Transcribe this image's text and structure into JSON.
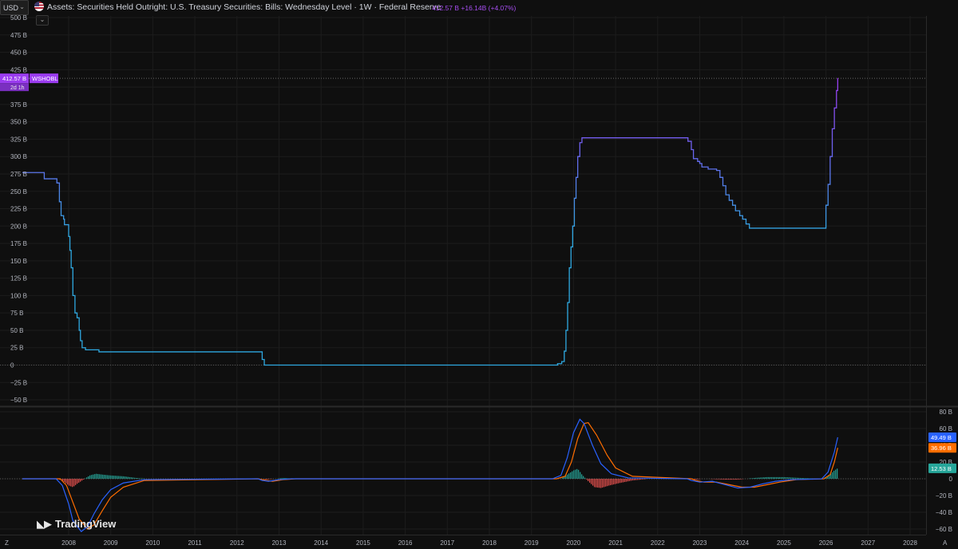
{
  "header": {
    "currency": "USD",
    "title": "Assets: Securities Held Outright: U.S. Treasury Securities: Bills: Wednesday Level · 1W · Federal Reserve",
    "value_text": "412.57 B  +16.14B (+4.07%)",
    "collapse_glyph": "⌄"
  },
  "brand": {
    "name": "TradingView"
  },
  "corner": {
    "left": "Z",
    "right": "A"
  },
  "colors": {
    "background": "#0f0f0f",
    "line_start": "#2ea8e0",
    "line_end": "#9b3cf0",
    "macd_line": "#2962ff",
    "signal_line": "#ff6d00",
    "hist_pos": "#26a69a",
    "hist_neg": "#ef5350"
  },
  "chart_data": [
    {
      "type": "line",
      "series": [
        {
          "name": "WSHOBL",
          "points": [
            [
              2006.9,
              277
            ],
            [
              2007.4,
              277
            ],
            [
              2007.42,
              268
            ],
            [
              2007.7,
              268
            ],
            [
              2007.72,
              262
            ],
            [
              2007.78,
              235
            ],
            [
              2007.82,
              215
            ],
            [
              2007.88,
              210
            ],
            [
              2007.9,
              202
            ],
            [
              2007.98,
              202
            ],
            [
              2008.0,
              185
            ],
            [
              2008.03,
              165
            ],
            [
              2008.06,
              140
            ],
            [
              2008.1,
              100
            ],
            [
              2008.15,
              75
            ],
            [
              2008.2,
              68
            ],
            [
              2008.25,
              50
            ],
            [
              2008.28,
              35
            ],
            [
              2008.32,
              25
            ],
            [
              2008.4,
              22
            ],
            [
              2008.7,
              22
            ],
            [
              2008.72,
              19
            ],
            [
              2012.55,
              19
            ],
            [
              2012.6,
              8
            ],
            [
              2012.65,
              0
            ],
            [
              2019.55,
              0
            ],
            [
              2019.62,
              2
            ],
            [
              2019.72,
              5
            ],
            [
              2019.78,
              20
            ],
            [
              2019.82,
              50
            ],
            [
              2019.86,
              90
            ],
            [
              2019.9,
              140
            ],
            [
              2019.94,
              170
            ],
            [
              2019.98,
              200
            ],
            [
              2020.02,
              240
            ],
            [
              2020.06,
              270
            ],
            [
              2020.1,
              300
            ],
            [
              2020.15,
              320
            ],
            [
              2020.2,
              327
            ],
            [
              2022.7,
              327
            ],
            [
              2022.72,
              322
            ],
            [
              2022.8,
              310
            ],
            [
              2022.85,
              297
            ],
            [
              2022.95,
              293
            ],
            [
              2023.0,
              290
            ],
            [
              2023.05,
              285
            ],
            [
              2023.2,
              282
            ],
            [
              2023.4,
              280
            ],
            [
              2023.48,
              270
            ],
            [
              2023.55,
              258
            ],
            [
              2023.62,
              245
            ],
            [
              2023.7,
              237
            ],
            [
              2023.78,
              230
            ],
            [
              2023.85,
              222
            ],
            [
              2023.95,
              215
            ],
            [
              2024.02,
              210
            ],
            [
              2024.1,
              203
            ],
            [
              2024.18,
              197
            ],
            [
              2025.95,
              197
            ],
            [
              2026.0,
              230
            ],
            [
              2026.05,
              260
            ],
            [
              2026.1,
              300
            ],
            [
              2026.15,
              340
            ],
            [
              2026.2,
              370
            ],
            [
              2026.25,
              395
            ],
            [
              2026.28,
              413
            ]
          ]
        }
      ],
      "x_ticks": [
        "2008",
        "2009",
        "2010",
        "2011",
        "2012",
        "2013",
        "2014",
        "2015",
        "2016",
        "2017",
        "2018",
        "2019",
        "2020",
        "2021",
        "2022",
        "2023",
        "2024",
        "2025",
        "2026",
        "2027",
        "2028"
      ],
      "y_ticks": [
        "500 B",
        "475 B",
        "450 B",
        "425 B",
        "400 B",
        "375 B",
        "350 B",
        "325 B",
        "300 B",
        "275 B",
        "250 B",
        "225 B",
        "200 B",
        "175 B",
        "150 B",
        "125 B",
        "100 B",
        "75 B",
        "50 B",
        "25 B",
        "0",
        "−25 B",
        "−50 B"
      ],
      "ylim": [
        -50,
        500
      ],
      "xlim": [
        2006.93,
        2028.86
      ],
      "last_label": {
        "value": 412.57,
        "text": "412.57 B",
        "symbol": "WSHOBL",
        "countdown": "2d 1h"
      }
    },
    {
      "type": "line",
      "series": [
        {
          "name": "MACD",
          "points": [
            [
              2006.9,
              0
            ],
            [
              2007.7,
              0
            ],
            [
              2007.85,
              -8
            ],
            [
              2008.0,
              -30
            ],
            [
              2008.1,
              -50
            ],
            [
              2008.3,
              -63
            ],
            [
              2008.45,
              -57
            ],
            [
              2008.6,
              -42
            ],
            [
              2008.8,
              -25
            ],
            [
              2009.0,
              -13
            ],
            [
              2009.3,
              -5
            ],
            [
              2009.8,
              -1
            ],
            [
              2012.5,
              0
            ],
            [
              2012.6,
              -2
            ],
            [
              2012.75,
              -3
            ],
            [
              2013.0,
              -1
            ],
            [
              2013.3,
              0
            ],
            [
              2019.5,
              0
            ],
            [
              2019.7,
              4
            ],
            [
              2019.85,
              25
            ],
            [
              2020.0,
              55
            ],
            [
              2020.15,
              71
            ],
            [
              2020.25,
              66
            ],
            [
              2020.45,
              40
            ],
            [
              2020.65,
              18
            ],
            [
              2020.9,
              6
            ],
            [
              2021.3,
              1
            ],
            [
              2022.7,
              0
            ],
            [
              2022.8,
              -2
            ],
            [
              2023.0,
              -4
            ],
            [
              2023.3,
              -3
            ],
            [
              2023.6,
              -7
            ],
            [
              2023.9,
              -11
            ],
            [
              2024.2,
              -10
            ],
            [
              2024.5,
              -6
            ],
            [
              2024.8,
              -3
            ],
            [
              2025.2,
              -1
            ],
            [
              2025.9,
              0
            ],
            [
              2026.05,
              8
            ],
            [
              2026.2,
              32
            ],
            [
              2026.28,
              49.49
            ]
          ]
        },
        {
          "name": "Signal",
          "points": [
            [
              2006.9,
              0
            ],
            [
              2007.8,
              0
            ],
            [
              2007.95,
              -8
            ],
            [
              2008.1,
              -28
            ],
            [
              2008.25,
              -48
            ],
            [
              2008.45,
              -60
            ],
            [
              2008.6,
              -55
            ],
            [
              2008.8,
              -38
            ],
            [
              2009.0,
              -22
            ],
            [
              2009.3,
              -10
            ],
            [
              2009.8,
              -2
            ],
            [
              2012.5,
              0
            ],
            [
              2012.7,
              -2
            ],
            [
              2012.85,
              -3
            ],
            [
              2013.1,
              -1
            ],
            [
              2013.4,
              0
            ],
            [
              2019.6,
              0
            ],
            [
              2019.8,
              3
            ],
            [
              2019.95,
              20
            ],
            [
              2020.1,
              48
            ],
            [
              2020.25,
              66
            ],
            [
              2020.35,
              67
            ],
            [
              2020.55,
              52
            ],
            [
              2020.8,
              28
            ],
            [
              2021.0,
              13
            ],
            [
              2021.4,
              3
            ],
            [
              2022.8,
              0
            ],
            [
              2022.9,
              -2
            ],
            [
              2023.1,
              -4
            ],
            [
              2023.4,
              -4
            ],
            [
              2023.7,
              -7
            ],
            [
              2024.0,
              -10
            ],
            [
              2024.3,
              -10
            ],
            [
              2024.6,
              -7
            ],
            [
              2024.9,
              -4
            ],
            [
              2025.3,
              -1
            ],
            [
              2025.95,
              0
            ],
            [
              2026.1,
              5
            ],
            [
              2026.2,
              20
            ],
            [
              2026.28,
              36.96
            ]
          ]
        },
        {
          "name": "Histogram",
          "points": [
            [
              2007.7,
              0
            ],
            [
              2007.85,
              -2
            ],
            [
              2008.0,
              -8
            ],
            [
              2008.1,
              -10
            ],
            [
              2008.2,
              -6
            ],
            [
              2008.35,
              -1
            ],
            [
              2008.5,
              4
            ],
            [
              2008.65,
              6
            ],
            [
              2008.8,
              5
            ],
            [
              2009.0,
              4
            ],
            [
              2009.3,
              3
            ],
            [
              2009.6,
              1
            ],
            [
              2009.9,
              0
            ],
            [
              2012.6,
              0
            ],
            [
              2012.7,
              -1
            ],
            [
              2012.9,
              0
            ],
            [
              2013.1,
              1
            ],
            [
              2013.4,
              0
            ],
            [
              2019.7,
              0
            ],
            [
              2019.85,
              5
            ],
            [
              2020.0,
              10
            ],
            [
              2020.1,
              12
            ],
            [
              2020.2,
              5
            ],
            [
              2020.35,
              -3
            ],
            [
              2020.5,
              -10
            ],
            [
              2020.65,
              -11
            ],
            [
              2020.85,
              -8
            ],
            [
              2021.1,
              -5
            ],
            [
              2021.4,
              -2
            ],
            [
              2021.8,
              0
            ],
            [
              2022.8,
              0
            ],
            [
              2022.9,
              -1
            ],
            [
              2023.1,
              0
            ],
            [
              2023.6,
              -1
            ],
            [
              2023.9,
              -1
            ],
            [
              2024.3,
              1
            ],
            [
              2024.6,
              2
            ],
            [
              2025.0,
              2
            ],
            [
              2025.4,
              1
            ],
            [
              2025.9,
              0
            ],
            [
              2026.05,
              3
            ],
            [
              2026.2,
              10
            ],
            [
              2026.28,
              12.53
            ]
          ]
        }
      ],
      "y_ticks": [
        "80 B",
        "60 B",
        "40 B",
        "20 B",
        "0",
        "−20 B",
        "−40 B",
        "−60 B"
      ],
      "ylim": [
        -80,
        88
      ],
      "last_labels": [
        {
          "series": "MACD",
          "text": "49.49 B"
        },
        {
          "series": "Signal",
          "text": "36.96 B"
        },
        {
          "series": "Histogram",
          "text": "12.53 B"
        }
      ]
    }
  ]
}
